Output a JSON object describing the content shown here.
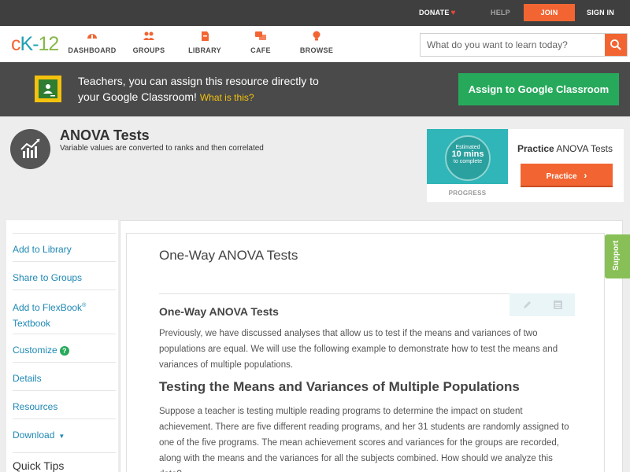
{
  "topbar": {
    "donate": "DONATE",
    "help": "HELP",
    "join": "JOIN",
    "signin": "SIGN IN"
  },
  "nav": {
    "logo_c": "c",
    "logo_k": "K",
    "logo_dash": "-",
    "logo_num": "12",
    "items": [
      {
        "label": "DASHBOARD",
        "icon": "dashboard-icon"
      },
      {
        "label": "GROUPS",
        "icon": "groups-icon"
      },
      {
        "label": "LIBRARY",
        "icon": "library-icon"
      },
      {
        "label": "CAFE",
        "icon": "cafe-icon"
      },
      {
        "label": "BROWSE",
        "icon": "browse-icon"
      }
    ],
    "search_placeholder": "What do you want to learn today?"
  },
  "banner": {
    "text": "Teachers, you can assign this resource directly to your Google Classroom!",
    "what": "What is this?",
    "assign": "Assign to Google Classroom"
  },
  "concept": {
    "title": "ANOVA Tests",
    "subtitle": "Variable values are converted to ranks and then correlated"
  },
  "practice": {
    "estimated": "Estimated",
    "mins": "10 mins",
    "to_complete": "to complete",
    "progress": "PROGRESS",
    "title_prefix": "Practice",
    "title_rest": "ANOVA Tests",
    "button": "Practice"
  },
  "sidebar": {
    "items": [
      "Add to Library",
      "Share to Groups",
      "Add to FlexBook",
      "Textbook",
      "Customize",
      "Details",
      "Resources",
      "Download"
    ],
    "flexbook_sup": "®",
    "quick_tips": "Quick Tips"
  },
  "content": {
    "page_heading": "One-Way ANOVA Tests",
    "section_heading": "One-Way ANOVA Tests",
    "para1": "Previously, we have discussed analyses that allow us to test if the means and variances of two populations are equal. We will use the following example to demonstrate how to test the means and variances of multiple populations.",
    "sub_heading": "Testing the Means and Variances of Multiple Populations",
    "para2": "Suppose a teacher is testing multiple reading programs to determine the impact on student achievement. There are five different reading programs, and her 31 students are randomly assigned to one of the five programs. The mean achievement scores and variances for the groups are recorded, along with the means and the variances for all the subjects combined. How should we analyze this data?"
  },
  "support": "Support",
  "colors": {
    "brand_orange": "#f26532",
    "brand_green": "#27a95c",
    "link_blue": "#1e88b4",
    "dark_bar": "#3f3f3f"
  }
}
